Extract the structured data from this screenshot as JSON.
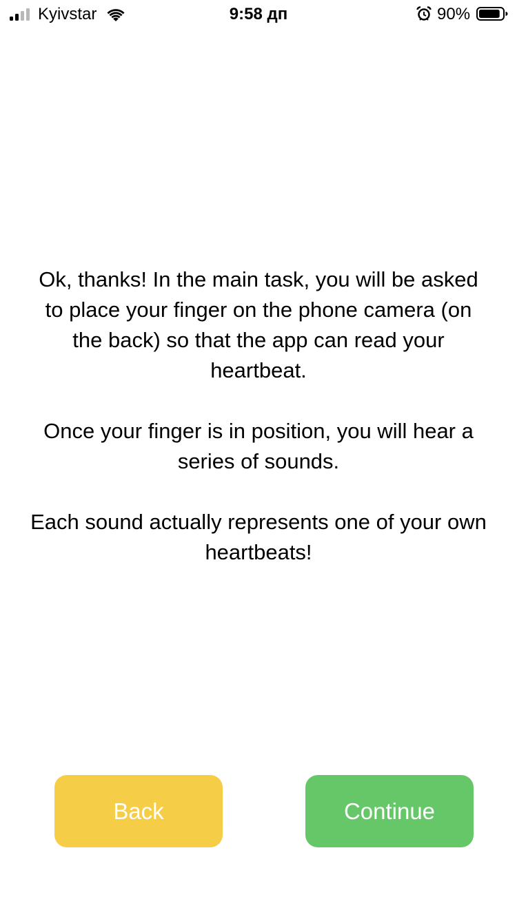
{
  "status_bar": {
    "carrier": "Kyivstar",
    "time": "9:58 дп",
    "battery_percent": "90%",
    "signal_bars_filled": 2,
    "signal_bars_total": 4,
    "battery_level": 0.9,
    "icons": [
      "signal-icon",
      "wifi-icon",
      "alarm-icon",
      "battery-icon"
    ]
  },
  "message": {
    "paragraphs": [
      "Ok, thanks! In the main task, you will be asked to place your finger on the phone camera (on the back) so that the app can read your heartbeat.",
      "Once your finger is in position, you will hear a series of sounds.",
      "Each sound actually represents one of your own heartbeats!"
    ]
  },
  "buttons": {
    "back_label": "Back",
    "continue_label": "Continue"
  },
  "colors": {
    "back_button": "#F5CD47",
    "continue_button": "#66C769",
    "button_text": "#FFFFFF",
    "background": "#FFFFFF",
    "signal_active": "#000000",
    "signal_inactive": "#B8B8B8"
  }
}
